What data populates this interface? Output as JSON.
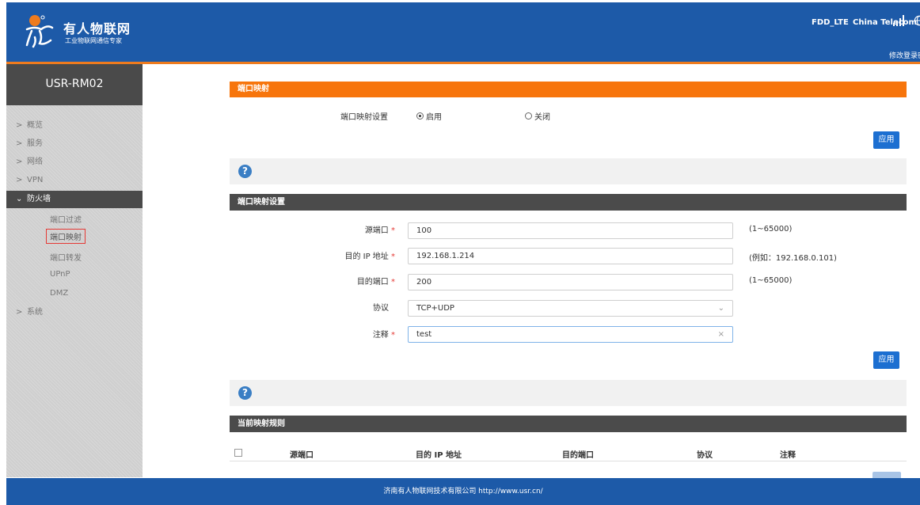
{
  "header": {
    "brand": "有人物联网",
    "brand_sub": "工业物联网通信专家",
    "net_type": "FDD_LTE",
    "carrier": "China Telecom",
    "change_password": "修改登录密"
  },
  "sidebar": {
    "device": "USR-RM02",
    "items": [
      {
        "label": "概览"
      },
      {
        "label": "服务"
      },
      {
        "label": "网络"
      },
      {
        "label": "VPN"
      },
      {
        "label": "防火墙"
      },
      {
        "label": "系统"
      }
    ],
    "firewall_sub": [
      "端口过滤",
      "端口映射",
      "端口转发",
      "UPnP",
      "DMZ"
    ]
  },
  "section1": {
    "title": "端口映射",
    "setting_label": "端口映射设置",
    "enable": "启用",
    "disable": "关闭",
    "apply": "应用"
  },
  "section2": {
    "title": "端口映射设置",
    "src_port_label": "源端口",
    "src_port_value": "100",
    "src_port_hint": "(1~65000)",
    "dest_ip_label": "目的 IP 地址",
    "dest_ip_value": "192.168.1.214",
    "dest_ip_hint": "(例如：192.168.0.101)",
    "dest_port_label": "目的端口",
    "dest_port_value": "200",
    "dest_port_hint": "(1~65000)",
    "protocol_label": "协议",
    "protocol_value": "TCP+UDP",
    "comment_label": "注释",
    "comment_value": "test",
    "required_mark": "*",
    "apply": "应用"
  },
  "section3": {
    "title": "当前映射规则",
    "columns": [
      "源端口",
      "目的 IP 地址",
      "目的端口",
      "协议",
      "注释"
    ]
  },
  "footer": {
    "text": "济南有人物联网技术有限公司  http://www.usr.cn/"
  },
  "colors": {
    "header_blue": "#1d5aa8",
    "accent_orange": "#f7750c",
    "button_blue": "#1c6fd1",
    "dark_bar": "#4b4b4b"
  }
}
